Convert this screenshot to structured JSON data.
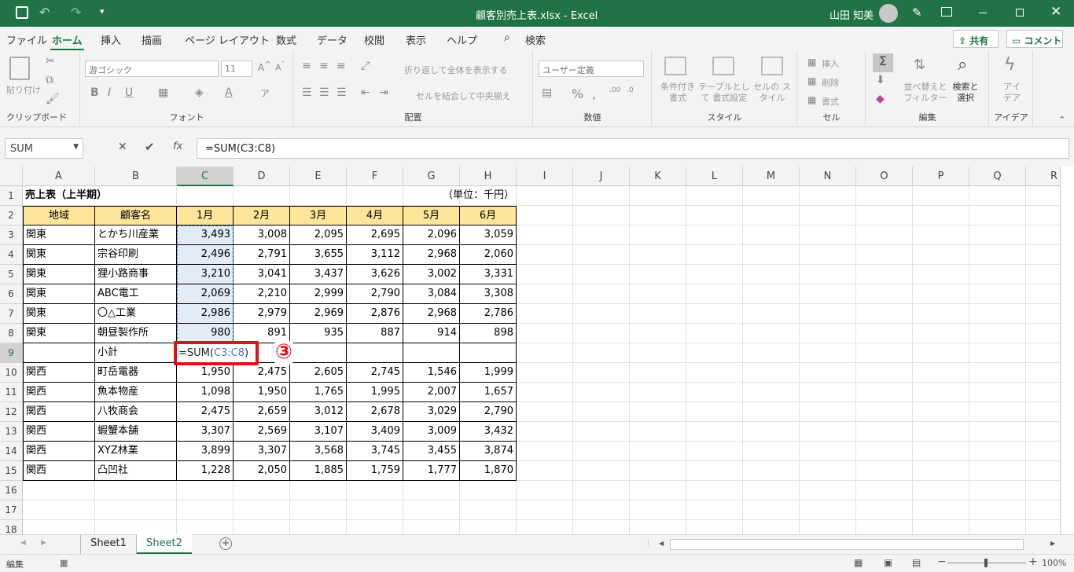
{
  "title": {
    "text": "顧客別売上表.xlsx  -  Excel",
    "user": "山田 知美"
  },
  "tabs": [
    "ファイル",
    "ホーム",
    "挿入",
    "描画",
    "ページ レイアウト",
    "数式",
    "データ",
    "校閲",
    "表示",
    "ヘルプ"
  ],
  "search": "検索",
  "share": "共有",
  "comment": "コメント",
  "ribbon": {
    "paste": "貼り付け",
    "font_name": "游ゴシック",
    "font_size": "11",
    "wrap": "折り返して全体を表示する",
    "merge": "セルを結合して中央揃え",
    "numfmt": "ユーザー定義",
    "cond": "条件付き 書式",
    "table": "テーブルとして 書式設定",
    "cellstyle": "セルの スタイル",
    "insert": "挿入",
    "delete": "削除",
    "format": "書式",
    "sort": "並べ替えと フィルター",
    "find": "検索と 選択",
    "ideas": "アイ デア",
    "groups": [
      "クリップボード",
      "フォント",
      "配置",
      "数値",
      "スタイル",
      "セル",
      "編集",
      "アイデア"
    ]
  },
  "namebox": "SUM",
  "formula": "=SUM(C3:C8)",
  "columns": [
    "A",
    "B",
    "C",
    "D",
    "E",
    "F",
    "G",
    "H",
    "I",
    "J",
    "K",
    "L",
    "M",
    "N",
    "O",
    "P",
    "Q",
    "R"
  ],
  "rows": [
    "1",
    "2",
    "3",
    "4",
    "5",
    "6",
    "7",
    "8",
    "9",
    "10",
    "11",
    "12",
    "13",
    "14",
    "15",
    "16",
    "17",
    "18"
  ],
  "sheet": {
    "title": "売上表（上半期）",
    "unit": "（単位：千円）",
    "headers": [
      "地域",
      "顧客名",
      "1月",
      "2月",
      "3月",
      "4月",
      "5月",
      "6月"
    ],
    "data": [
      [
        "関東",
        "とかち川産業",
        "3,493",
        "3,008",
        "2,095",
        "2,695",
        "2,096",
        "3,059"
      ],
      [
        "関東",
        "宗谷印刷",
        "2,496",
        "2,791",
        "3,655",
        "3,112",
        "2,968",
        "2,060"
      ],
      [
        "関東",
        "狸小路商事",
        "3,210",
        "3,041",
        "3,437",
        "3,626",
        "3,002",
        "3,331"
      ],
      [
        "関東",
        "ABC電工",
        "2,069",
        "2,210",
        "2,999",
        "2,790",
        "3,084",
        "3,308"
      ],
      [
        "関東",
        "〇△工業",
        "2,986",
        "2,979",
        "2,969",
        "2,876",
        "2,968",
        "2,786"
      ],
      [
        "関東",
        "朝昼製作所",
        "980",
        "891",
        "935",
        "887",
        "914",
        "898"
      ],
      [
        "",
        "小計",
        "",
        "",
        "",
        "",
        "",
        ""
      ],
      [
        "関西",
        "町岳電器",
        "1,950",
        "2,475",
        "2,605",
        "2,745",
        "1,546",
        "1,999"
      ],
      [
        "関西",
        "魚本物産",
        "1,098",
        "1,950",
        "1,765",
        "1,995",
        "2,007",
        "1,657"
      ],
      [
        "関西",
        "八牧商会",
        "2,475",
        "2,659",
        "3,012",
        "2,678",
        "3,029",
        "2,790"
      ],
      [
        "関西",
        "蝦蟹本舗",
        "3,307",
        "2,569",
        "3,107",
        "3,409",
        "3,009",
        "3,432"
      ],
      [
        "関西",
        "XYZ林業",
        "3,899",
        "3,307",
        "3,568",
        "3,745",
        "3,455",
        "3,874"
      ],
      [
        "関西",
        "凸凹社",
        "1,228",
        "2,050",
        "1,885",
        "1,759",
        "1,777",
        "1,870"
      ]
    ],
    "edit_prefix": "=SUM(",
    "edit_ref": "C3:C8",
    "edit_suffix": ")",
    "callout": "③"
  },
  "sheets": [
    "Sheet1",
    "Sheet2"
  ],
  "status": {
    "mode": "編集",
    "zoom": "100%"
  },
  "colors": {
    "excel_green": "#217346",
    "header_fill": "#fde59a",
    "highlight_red": "#e0101a",
    "ref_blue": "#3c78d8"
  }
}
